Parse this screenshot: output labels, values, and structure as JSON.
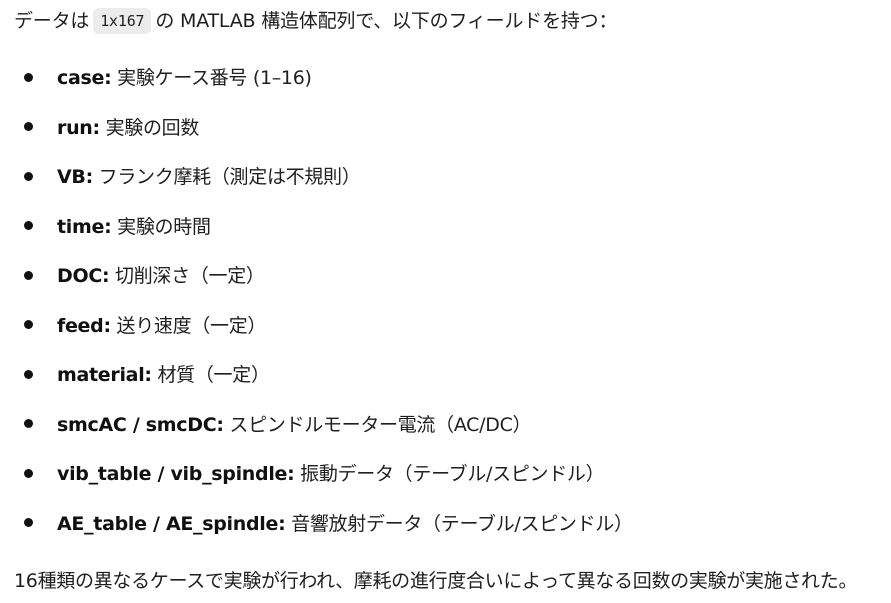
{
  "intro": {
    "before": "データは",
    "code": "1x167",
    "after": "の MATLAB 構造体配列で、以下のフィールドを持つ："
  },
  "fields": [
    {
      "key": "case:",
      "desc": "実験ケース番号 (1–16)"
    },
    {
      "key": "run:",
      "desc": "実験の回数"
    },
    {
      "key": "VB:",
      "desc": "フランク摩耗（測定は不規則）"
    },
    {
      "key": "time:",
      "desc": "実験の時間"
    },
    {
      "key": "DOC:",
      "desc": "切削深さ（一定）"
    },
    {
      "key": "feed:",
      "desc": "送り速度（一定）"
    },
    {
      "key": "material:",
      "desc": "材質（一定）"
    },
    {
      "key": "smcAC / smcDC:",
      "desc": "スピンドルモーター電流（AC/DC）"
    },
    {
      "key": "vib_table / vib_spindle:",
      "desc": "振動データ（テーブル/スピンドル）"
    },
    {
      "key": "AE_table / AE_spindle:",
      "desc": "音響放射データ（テーブル/スピンドル）"
    }
  ],
  "footer": "16種類の異なるケースで実験が行われ、摩耗の進行度合いによって異なる回数の実験が実施された。"
}
